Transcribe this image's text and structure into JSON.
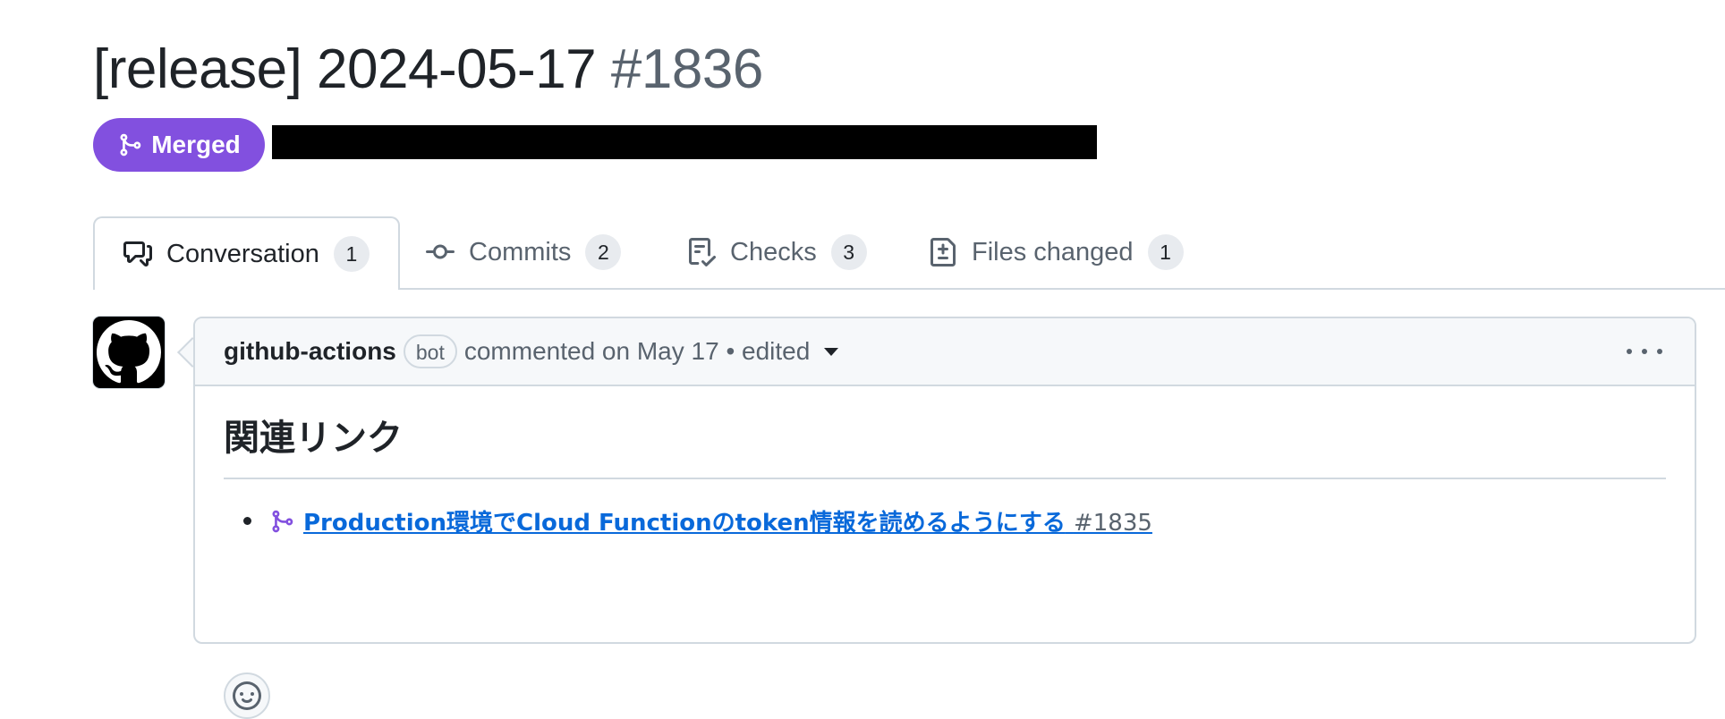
{
  "pr": {
    "title": "[release] 2024-05-17",
    "number": "#1836",
    "state_label": "Merged"
  },
  "tabs": [
    {
      "label": "Conversation",
      "count": "1",
      "icon": "comment-discussion-icon",
      "active": true
    },
    {
      "label": "Commits",
      "count": "2",
      "icon": "git-commit-icon",
      "active": false
    },
    {
      "label": "Checks",
      "count": "3",
      "icon": "checklist-icon",
      "active": false
    },
    {
      "label": "Files changed",
      "count": "1",
      "icon": "file-diff-icon",
      "active": false
    }
  ],
  "comment": {
    "author": "github-actions",
    "author_badge": "bot",
    "meta": "commented on May 17 • edited",
    "heading": "関連リンク",
    "links": [
      {
        "text": "Production環境でCloud Functionのtoken情報を読めるようにする",
        "number": "#1835"
      }
    ]
  },
  "colors": {
    "merged": "#8250df",
    "link": "#0969da",
    "muted": "#59636e",
    "border": "#d1d9e0"
  }
}
